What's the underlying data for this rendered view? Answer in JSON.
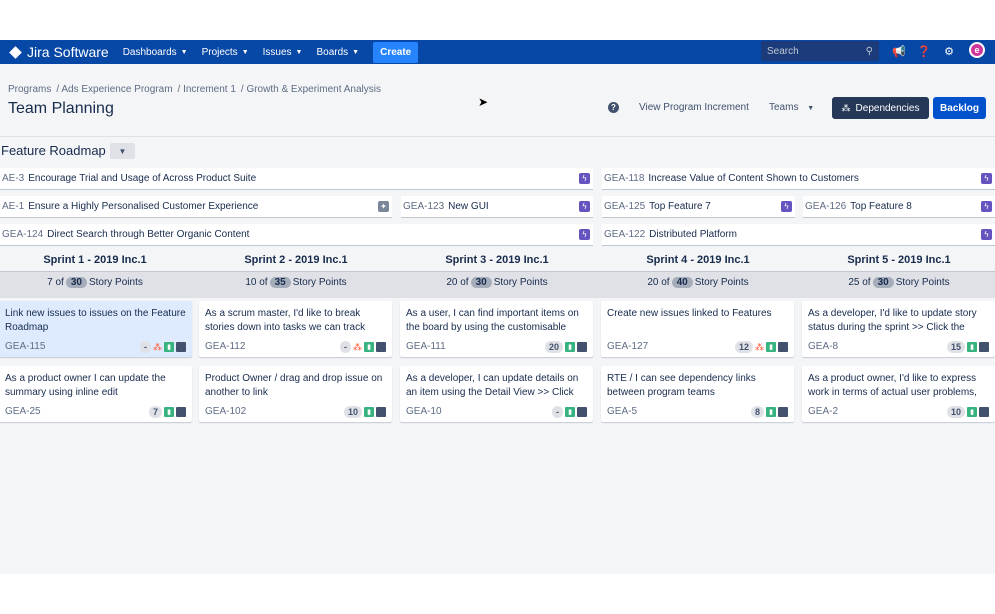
{
  "nav": {
    "logo": "Jira Software",
    "items": [
      "Dashboards",
      "Projects",
      "Issues",
      "Boards"
    ],
    "create": "Create",
    "search_placeholder": "Search",
    "avatar_letter": "e"
  },
  "breadcrumb": [
    "Programs",
    "/ Ads Experience Program",
    "/ Increment 1",
    "/ Growth & Experiment Analysis"
  ],
  "page_title": "Team Planning",
  "header": {
    "help": "?",
    "view_pi": "View Program Increment",
    "teams": "Teams",
    "dependencies": "Dependencies",
    "backlog": "Backlog"
  },
  "roadmap": {
    "title": "Feature Roadmap",
    "features": [
      {
        "key": "AE-3",
        "title": "Encourage Trial and Usage of Across Product Suite"
      },
      {
        "key": "GEA-118",
        "title": "Increase Value of Content Shown to Customers"
      },
      {
        "key": "AE-1",
        "title": "Ensure a Highly Personalised Customer Experience"
      },
      {
        "key": "GEA-123",
        "title": "New GUI"
      },
      {
        "key": "GEA-125",
        "title": "Top Feature 7"
      },
      {
        "key": "GEA-126",
        "title": "Top Feature 8"
      },
      {
        "key": "GEA-124",
        "title": "Direct Search through Better Organic Content"
      },
      {
        "key": "GEA-122",
        "title": "Distributed Platform"
      }
    ]
  },
  "sprints": [
    {
      "name": "Sprint 1 - 2019 Inc.1",
      "used": "7 of",
      "capacity": "30",
      "unit": "Story Points"
    },
    {
      "name": "Sprint 2 - 2019 Inc.1",
      "used": "10 of",
      "capacity": "35",
      "unit": "Story Points"
    },
    {
      "name": "Sprint 3 - 2019 Inc.1",
      "used": "20 of",
      "capacity": "30",
      "unit": "Story Points"
    },
    {
      "name": "Sprint 4 - 2019 Inc.1",
      "used": "20 of",
      "capacity": "40",
      "unit": "Story Points"
    },
    {
      "name": "Sprint 5 - 2019 Inc.1",
      "used": "25 of",
      "capacity": "30",
      "unit": "Story Points"
    }
  ],
  "cards": [
    {
      "summary": "Link new issues to issues on the Feature Roadmap",
      "key": "GEA-115",
      "estimate": "-"
    },
    {
      "summary": "As a scrum master, I'd like to break stories down into tasks we can track",
      "key": "GEA-112",
      "estimate": "-"
    },
    {
      "summary": "As a user, I can find important items on the board by using the customisable",
      "key": "GEA-111",
      "estimate": "20"
    },
    {
      "summary": "Create new issues linked to Features",
      "key": "GEA-127",
      "estimate": "12"
    },
    {
      "summary": "As a developer, I'd like to update story status during the sprint >> Click the",
      "key": "GEA-8",
      "estimate": "15"
    },
    {
      "summary": "As a product owner I can update the summary using inline edit",
      "key": "GEA-25",
      "estimate": "7"
    },
    {
      "summary": "Product Owner / drag and drop issue on another to link",
      "key": "GEA-102",
      "estimate": "10"
    },
    {
      "summary": "As a developer, I can update details on an item using the Detail View >> Click",
      "key": "GEA-10",
      "estimate": "-"
    },
    {
      "summary": "RTE / I can see dependency links between program teams",
      "key": "GEA-5",
      "estimate": "8"
    },
    {
      "summary": "As a product owner, I'd like to express work in terms of actual user problems,",
      "key": "GEA-2",
      "estimate": "10"
    }
  ],
  "colors": {
    "nav": "#0747a6",
    "create": "#2684ff",
    "backlog": "#0052cc",
    "dependencies": "#253858",
    "feature_icon": "#6554c0",
    "story_icon": "#36b37e",
    "selected_card": "#deebff"
  }
}
